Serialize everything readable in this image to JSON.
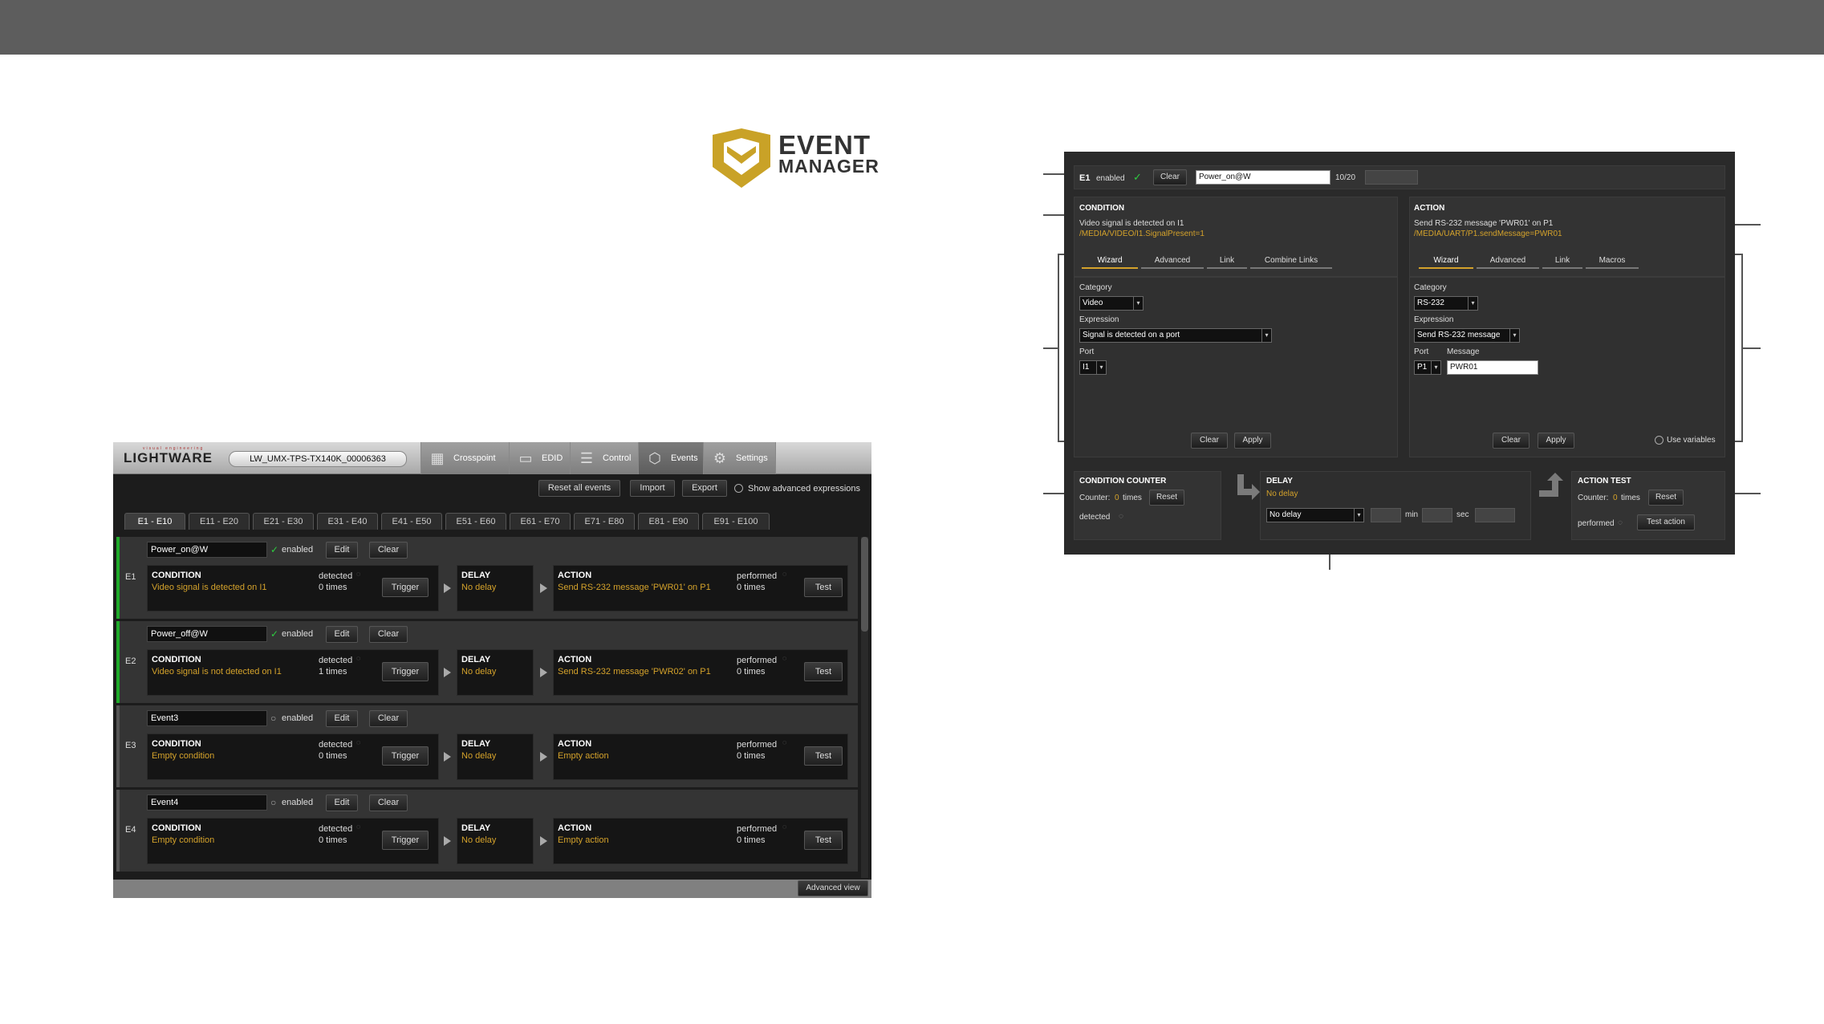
{
  "logo": {
    "line1": "EVENT",
    "line2": "MANAGER"
  },
  "app": {
    "brand": "LIGHTWARE",
    "brand_sub": "visual engineering",
    "device_name": "LW_UMX-TPS-TX140K_00006363",
    "nav_tabs": [
      {
        "label": "Crosspoint",
        "icon": "crosspoint-icon"
      },
      {
        "label": "EDID",
        "icon": "monitor-icon"
      },
      {
        "label": "Control",
        "icon": "sliders-icon"
      },
      {
        "label": "Events",
        "icon": "event-icon"
      },
      {
        "label": "Settings",
        "icon": "gear-icon"
      }
    ],
    "toolbar": {
      "reset_all": "Reset all events",
      "import": "Import",
      "export": "Export",
      "show_advanced": "Show advanced expressions"
    },
    "range_tabs": [
      "E1 - E10",
      "E11 - E20",
      "E21 - E30",
      "E31 - E40",
      "E41 - E50",
      "E51 - E60",
      "E61 - E70",
      "E71 - E80",
      "E81 - E90",
      "E91 - E100"
    ],
    "events": [
      {
        "id": "E1",
        "name": "Power_on@W",
        "enabled_label": "enabled",
        "edit": "Edit",
        "clear": "Clear",
        "condition_title": "CONDITION",
        "condition": "Video signal is detected on I1",
        "detected": "detected",
        "detected_count": "0 times",
        "trigger": "Trigger",
        "delay_title": "DELAY",
        "delay": "No delay",
        "action_title": "ACTION",
        "action": "Send RS-232 message 'PWR01' on P1",
        "performed": "performed",
        "performed_count": "0 times",
        "test": "Test"
      },
      {
        "id": "E2",
        "name": "Power_off@W",
        "enabled_label": "enabled",
        "edit": "Edit",
        "clear": "Clear",
        "condition_title": "CONDITION",
        "condition": "Video signal is not detected on I1",
        "detected": "detected",
        "detected_count": "1 times",
        "trigger": "Trigger",
        "delay_title": "DELAY",
        "delay": "No delay",
        "action_title": "ACTION",
        "action": "Send RS-232 message 'PWR02' on P1",
        "performed": "performed",
        "performed_count": "0 times",
        "test": "Test"
      },
      {
        "id": "E3",
        "name": "Event3",
        "enabled_label": "enabled",
        "edit": "Edit",
        "clear": "Clear",
        "condition_title": "CONDITION",
        "condition": "Empty condition",
        "detected": "detected",
        "detected_count": "0 times",
        "trigger": "Trigger",
        "delay_title": "DELAY",
        "delay": "No delay",
        "action_title": "ACTION",
        "action": "Empty action",
        "performed": "performed",
        "performed_count": "0 times",
        "test": "Test"
      },
      {
        "id": "E4",
        "name": "Event4",
        "enabled_label": "enabled",
        "edit": "Edit",
        "clear": "Clear",
        "condition_title": "CONDITION",
        "condition": "Empty condition",
        "detected": "detected",
        "detected_count": "0 times",
        "trigger": "Trigger",
        "delay_title": "DELAY",
        "delay": "No delay",
        "action_title": "ACTION",
        "action": "Empty action",
        "performed": "performed",
        "performed_count": "0 times",
        "test": "Test"
      }
    ],
    "advanced_view": "Advanced view"
  },
  "detail": {
    "event_id": "E1",
    "enabled_label": "enabled",
    "clear": "Clear",
    "name": "Power_on@W",
    "name_count": "10/20",
    "condition": {
      "title": "CONDITION",
      "summary": "Video signal is detected on I1",
      "path": "/MEDIA/VIDEO/I1.SignalPresent=1",
      "tabs": [
        "Wizard",
        "Advanced",
        "Link",
        "Combine Links"
      ],
      "category_label": "Category",
      "category": "Video",
      "expression_label": "Expression",
      "expression": "Signal is detected on a port",
      "port_label": "Port",
      "port": "I1",
      "clear": "Clear",
      "apply": "Apply"
    },
    "action": {
      "title": "ACTION",
      "summary": "Send RS-232 message 'PWR01' on P1",
      "path": "/MEDIA/UART/P1.sendMessage=PWR01",
      "tabs": [
        "Wizard",
        "Advanced",
        "Link",
        "Macros"
      ],
      "category_label": "Category",
      "category": "RS-232",
      "expression_label": "Expression",
      "expression": "Send RS-232 message",
      "port_label": "Port",
      "port": "P1",
      "message_label": "Message",
      "message": "PWR01",
      "clear": "Clear",
      "apply": "Apply",
      "use_variables": "Use variables"
    },
    "condition_counter": {
      "title": "CONDITION COUNTER",
      "counter_prefix": "Counter:",
      "counter_value": "0",
      "counter_suffix": "times",
      "reset": "Reset",
      "detected": "detected"
    },
    "delay": {
      "title": "DELAY",
      "summary": "No delay",
      "select": "No delay",
      "min_label": "min",
      "sec_label": "sec"
    },
    "action_test": {
      "title": "ACTION TEST",
      "counter_prefix": "Counter:",
      "counter_value": "0",
      "counter_suffix": "times",
      "reset": "Reset",
      "performed": "performed",
      "test_action": "Test action"
    }
  }
}
